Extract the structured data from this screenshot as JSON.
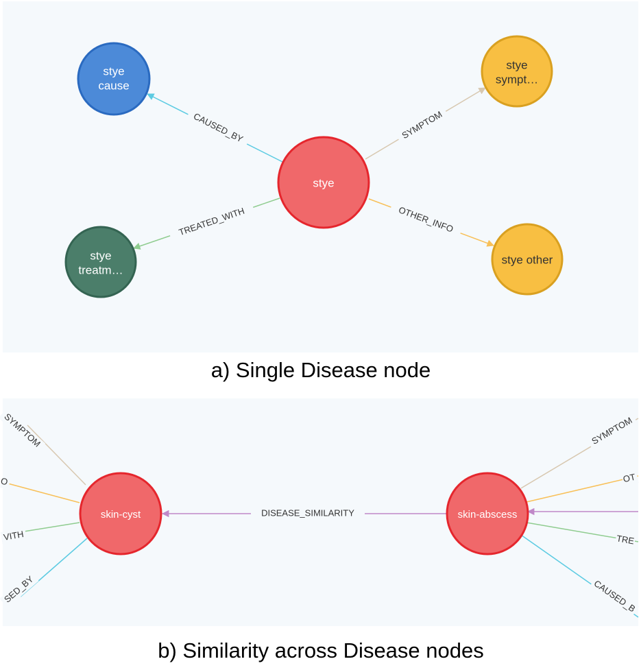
{
  "colors": {
    "disease": "#f0686a",
    "disease_stroke": "#e5262d",
    "cause": "#4c8ad8",
    "cause_stroke": "#2a6ac0",
    "treatment": "#4b7e6a",
    "treatment_stroke": "#346452",
    "symptom": "#f8bf42",
    "symptom_stroke": "#d9a020",
    "caused_by_edge": "#5ccbe2",
    "symptom_edge": "#d8c8b0",
    "treated_with_edge": "#8fcc8f",
    "other_info_edge": "#f8c058",
    "similarity_edge": "#c088c8"
  },
  "diagram_a": {
    "caption": "a) Single Disease node",
    "nodes": {
      "center": "stye",
      "cause": [
        "stye",
        "cause"
      ],
      "symptom": [
        "stye",
        "sympt…"
      ],
      "treatment": [
        "stye",
        "treatm…"
      ],
      "other": [
        "stye other"
      ]
    },
    "edges": {
      "caused_by": "CAUSED_BY",
      "symptom": "SYMPTOM",
      "treated_with": "TREATED_WITH",
      "other_info": "OTHER_INFO"
    }
  },
  "diagram_b": {
    "caption": "b) Similarity across Disease nodes",
    "nodes": {
      "left": "skin-cyst",
      "right": "skin-abscess"
    },
    "edges": {
      "similarity": "DISEASE_SIMILARITY",
      "left_symptom": "SYMPTOM",
      "left_other": "O",
      "left_treated": "VITH",
      "left_caused": "SED_BY",
      "right_symptom": "SYMPTOM",
      "right_other": "OT",
      "right_treated": "TRE",
      "right_caused": "CAUSED_B"
    }
  }
}
